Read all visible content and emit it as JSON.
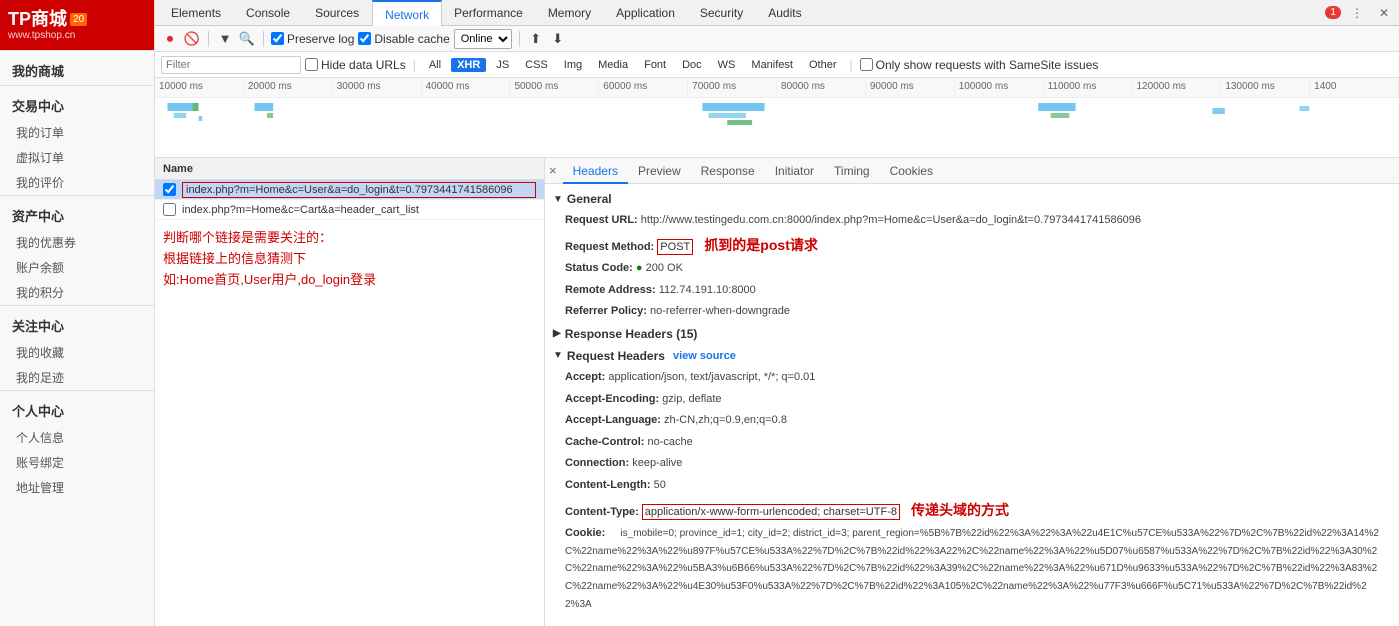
{
  "sidebar": {
    "logo": {
      "main": "TP商城",
      "badge": "20",
      "url": "www.tpshop.cn"
    },
    "section_my": "我的商城",
    "section_trade": "交易中心",
    "trade_items": [
      "我的订单",
      "虚拟订单",
      "我的评价"
    ],
    "section_assets": "资产中心",
    "assets_items": [
      "我的优惠券",
      "账户余额",
      "我的积分"
    ],
    "section_follow": "关注中心",
    "follow_items": [
      "我的收藏",
      "我的足迹"
    ],
    "section_personal": "个人中心",
    "personal_items": [
      "个人信息",
      "账号绑定",
      "地址管理"
    ]
  },
  "devtools": {
    "tabs": [
      {
        "label": "Elements",
        "active": false
      },
      {
        "label": "Console",
        "active": false
      },
      {
        "label": "Sources",
        "active": false
      },
      {
        "label": "Network",
        "active": true
      },
      {
        "label": "Performance",
        "active": false
      },
      {
        "label": "Memory",
        "active": false
      },
      {
        "label": "Application",
        "active": false
      },
      {
        "label": "Security",
        "active": false
      },
      {
        "label": "Audits",
        "active": false
      }
    ],
    "error_count": "1",
    "toolbar": {
      "preserve_log": "Preserve log",
      "disable_cache": "Disable cache",
      "online": "Online"
    },
    "filter": {
      "placeholder": "Filter",
      "hide_data_urls": "Hide data URLs",
      "all": "All",
      "xhr": "XHR",
      "js": "JS",
      "css": "CSS",
      "img": "Img",
      "media": "Media",
      "font": "Font",
      "doc": "Doc",
      "ws": "WS",
      "manifest": "Manifest",
      "other": "Other",
      "same_site": "Only show requests with SameSite issues"
    },
    "timeline": {
      "ticks": [
        "10000 ms",
        "20000 ms",
        "30000 ms",
        "40000 ms",
        "50000 ms",
        "60000 ms",
        "70000 ms",
        "80000 ms",
        "90000 ms",
        "100000 ms",
        "110000 ms",
        "120000 ms",
        "130000 ms",
        "1400"
      ]
    },
    "requests": {
      "header": "Name",
      "items": [
        {
          "name": "index.php?m=Home&c=User&a=do_login&t=0.7973441741586096",
          "selected": true,
          "has_border": true
        },
        {
          "name": "index.php?m=Home&c=Cart&a=header_cart_list",
          "selected": false,
          "has_border": false
        }
      ]
    },
    "annotation1": "判断哪个链接是需要关注的：\n根据链接上的信息猜测下\n如:Home首页,User用户,do_login登录",
    "details": {
      "close": "×",
      "tabs": [
        {
          "label": "Headers",
          "active": true
        },
        {
          "label": "Preview",
          "active": false
        },
        {
          "label": "Response",
          "active": false
        },
        {
          "label": "Initiator",
          "active": false
        },
        {
          "label": "Timing",
          "active": false
        },
        {
          "label": "Cookies",
          "active": false
        }
      ],
      "general": {
        "title": "General",
        "request_url_label": "Request URL:",
        "request_url_value": "http://www.testingedu.com.cn:8000/index.php?m=Home&c=User&a=do_login&t=0.7973441741586096",
        "method_label": "Request Method:",
        "method_value": "POST",
        "status_label": "Status Code:",
        "status_value": "200 OK",
        "remote_label": "Remote Address:",
        "remote_value": "112.74.191.10:8000",
        "referrer_label": "Referrer Policy:",
        "referrer_value": "no-referrer-when-downgrade"
      },
      "annotation_post": "抓到的是post请求",
      "response_headers": {
        "title": "Response Headers (15)"
      },
      "request_headers": {
        "title": "Request Headers",
        "view_source": "view source",
        "accept_label": "Accept:",
        "accept_value": "application/json, text/javascript, */*; q=0.01",
        "encoding_label": "Accept-Encoding:",
        "encoding_value": "gzip, deflate",
        "language_label": "Accept-Language:",
        "language_value": "zh-CN,zh;q=0.9,en;q=0.8",
        "cache_label": "Cache-Control:",
        "cache_value": "no-cache",
        "connection_label": "Connection:",
        "connection_value": "keep-alive",
        "length_label": "Content-Length:",
        "length_value": "50",
        "type_label": "Content-Type:",
        "type_value": "application/x-www-form-urlencoded; charset=UTF-8",
        "annotation_type": "传递头域的方式",
        "cookie_label": "Cookie:",
        "cookie_value": "is_mobile=0; province_id=1; city_id=2; district_id=3; parent_region=%5B%7B%22id%22%3A%22%3A%22u4E1C%u57CE%u533A%22%7D%2C%7B%22id%22%3A14%2C%22name%22%3A%22%u897F%u57CE%u533A%22%7D%2C%7B%22id%22%3A22%2C%22name%22%3A%22%u5D07%u6587%u533A%22%7D%2C%7B%22id%22%3A30%2C%22name%22%3A%22%u5BA3%u6B66%u533A%22%7D%2C%7B%22id%22%3A39%2C%22name%22%3A%22%u671D%u9633%u533A%22%7D%2C%7B%22id%22%3A83%2C%22name%22%3A%22%u4E30%u53F0%u533A%22%7D%2C%7B%22id%22%3A105%2C%22name%22%3A%22%u77F3%u666F%u5C71%u533A%22%7D%2C%7B%22id%22%3A"
      }
    }
  }
}
